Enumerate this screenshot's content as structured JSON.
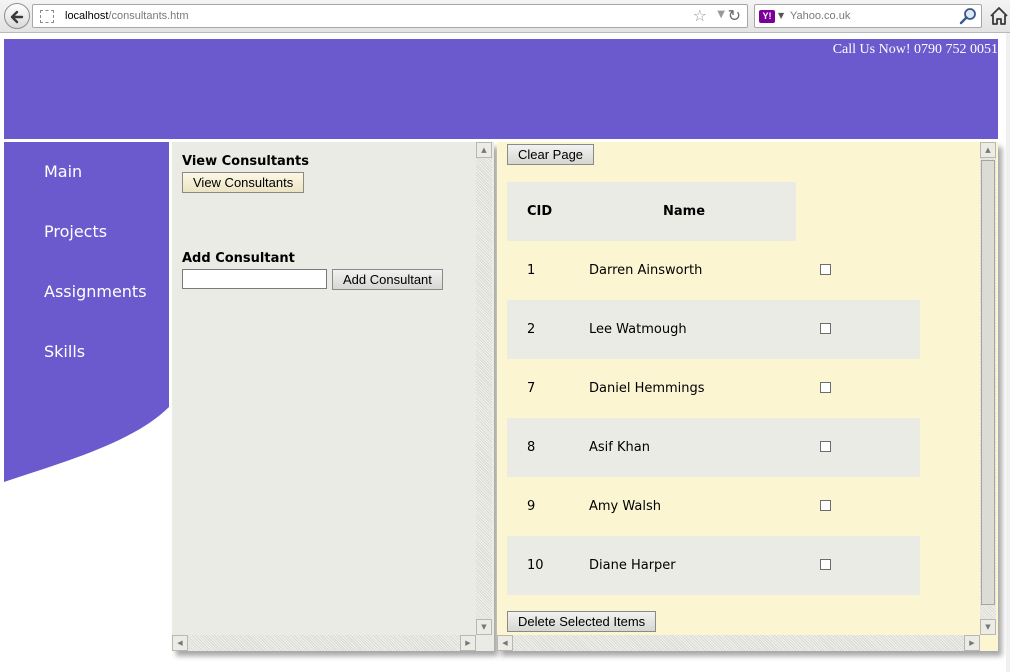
{
  "browser": {
    "url_host": "localhost",
    "url_path": "/consultants.htm",
    "search_text": "Yahoo.co.uk",
    "search_engine_icon": "Y!"
  },
  "header": {
    "call_us": "Call Us Now! 0790 752 0051",
    "color": "#6a5acd"
  },
  "nav": {
    "items": [
      {
        "label": "Main"
      },
      {
        "label": "Projects"
      },
      {
        "label": "Assignments"
      },
      {
        "label": "Skills"
      }
    ]
  },
  "left_panel": {
    "view_title": "View Consultants",
    "view_button": "View Consultants",
    "add_title": "Add Consultant",
    "add_input_value": "",
    "add_button": "Add Consultant"
  },
  "right_panel": {
    "clear_button": "Clear Page",
    "delete_button": "Delete Selected Items",
    "table": {
      "headers": {
        "cid": "CID",
        "name": "Name"
      },
      "rows": [
        {
          "cid": "1",
          "name": "Darren Ainsworth",
          "checked": false
        },
        {
          "cid": "2",
          "name": "Lee Watmough",
          "checked": false
        },
        {
          "cid": "7",
          "name": "Daniel Hemmings",
          "checked": false
        },
        {
          "cid": "8",
          "name": "Asif Khan",
          "checked": false
        },
        {
          "cid": "9",
          "name": "Amy Walsh",
          "checked": false
        },
        {
          "cid": "10",
          "name": "Diane Harper",
          "checked": false
        }
      ]
    }
  },
  "colors": {
    "accent": "#6a5acd",
    "left_panel_bg": "#ebebe6",
    "right_panel_bg": "#fbf5d2"
  }
}
